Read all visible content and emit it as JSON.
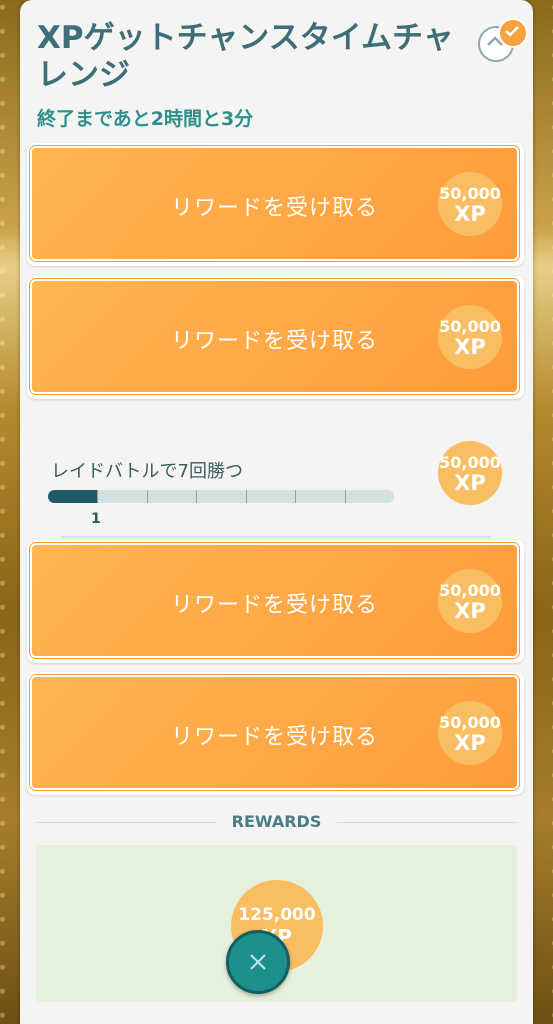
{
  "header": {
    "title": "XPゲットチャンスタイムチャレンジ",
    "time_remaining": "終了まであと2時間と3分"
  },
  "claim_label": "リワードを受け取る",
  "xp": {
    "amount": "50,000",
    "unit": "XP"
  },
  "tasks": [
    {
      "type": "claimable"
    },
    {
      "type": "claimable"
    },
    {
      "type": "progress",
      "label": "レイドバトルで7回勝つ",
      "progress_current": "1",
      "progress_total": 7
    },
    {
      "type": "claimable"
    },
    {
      "type": "claimable"
    }
  ],
  "rewards": {
    "title": "REWARDS",
    "amount": "125,000",
    "unit": "XP"
  },
  "colors": {
    "accent_orange": "#ff9b3a",
    "progress_fill": "#205a68",
    "title_teal": "#3e6f78",
    "close_teal": "#1d8f8c"
  },
  "icons": [
    "chevron-up-icon",
    "checkmark-icon",
    "close-icon"
  ]
}
